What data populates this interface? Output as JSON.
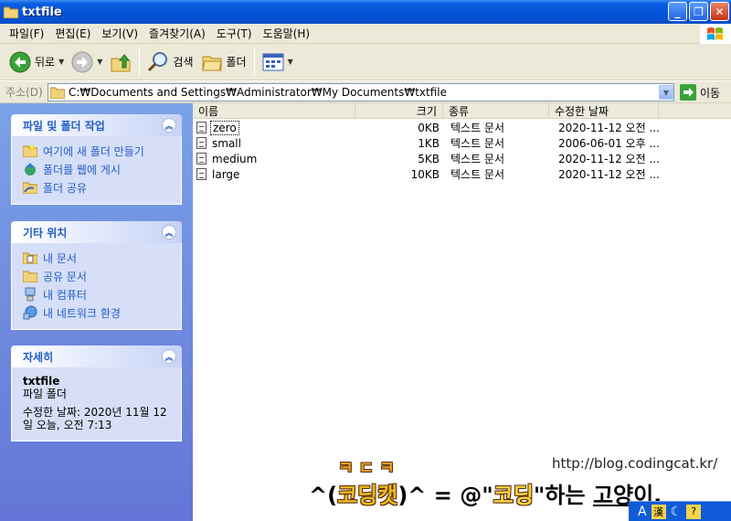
{
  "window": {
    "title": "txtfile",
    "buttons": [
      "_",
      "❐",
      "✕"
    ]
  },
  "menu": [
    "파일(F)",
    "편집(E)",
    "보기(V)",
    "즐겨찾기(A)",
    "도구(T)",
    "도움말(H)"
  ],
  "toolbar": {
    "back_label": "뒤로",
    "search_label": "검색",
    "folders_label": "폴더"
  },
  "address": {
    "label": "주소(D)",
    "value": "C:₩Documents and Settings₩Administrator₩My Documents₩txtfile",
    "go_label": "이동"
  },
  "tasks_panel": {
    "title": "파일 및 폴더 작업",
    "items": [
      "여기에 새 폴더 만들기",
      "폴더를 웹에 게시",
      "폴더 공유"
    ]
  },
  "places_panel": {
    "title": "기타 위치",
    "items": [
      "내 문서",
      "공유 문서",
      "내 컴퓨터",
      "내 네트워크 환경"
    ]
  },
  "details_panel": {
    "title": "자세히",
    "name": "txtfile",
    "type": "파일 폴더",
    "modified_line1": "수정한 날짜: 2020년 11월 12",
    "modified_line2": "일 오늘, 오전 7:13"
  },
  "columns": {
    "name": "이름",
    "size": "크기",
    "type": "종류",
    "date": "수정한 날짜"
  },
  "files": [
    {
      "name": "zero",
      "size": "0KB",
      "type": "텍스트 문서",
      "date": "2020-11-12 오전 ..."
    },
    {
      "name": "small",
      "size": "1KB",
      "type": "텍스트 문서",
      "date": "2006-06-01 오후 ..."
    },
    {
      "name": "medium",
      "size": "5KB",
      "type": "텍스트 문서",
      "date": "2020-11-12 오전 ..."
    },
    {
      "name": "large",
      "size": "10KB",
      "type": "텍스트 문서",
      "date": "2020-11-12 오전 ..."
    }
  ],
  "watermark": {
    "top": "ㅋㄷㅋ",
    "url": "http://blog.codingcat.kr/",
    "main_prefix": "^(",
    "main_cat": "코딩캣",
    "main_mid": ")^ = @\"",
    "main_coding": "코딩",
    "main_mid2": "\"하는 ",
    "main_suffix": "고양이."
  },
  "ime": {
    "lang": "A",
    "hanja": "漢"
  }
}
